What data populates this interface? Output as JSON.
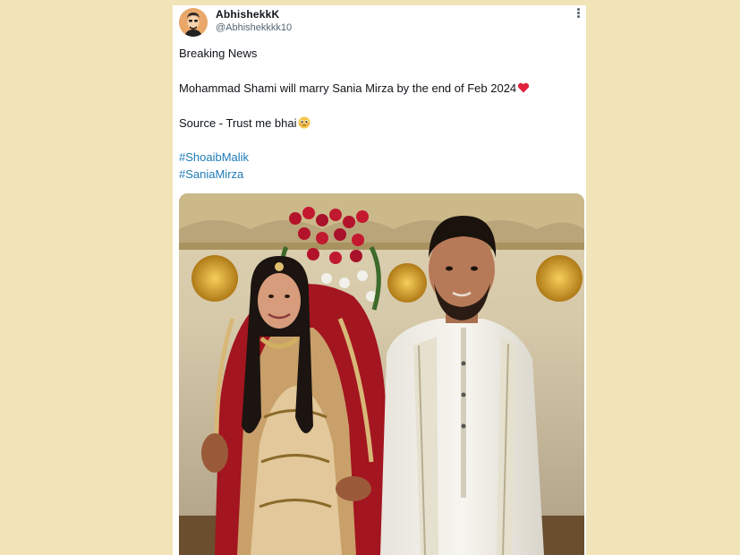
{
  "tweet": {
    "display_name": "AbhishekkK",
    "handle": "@Abhishekkkk10",
    "line1": "Breaking News",
    "line2": "Mohammad Shami will marry Sania Mirza by the end of Feb 2024",
    "line3": "Source - Trust me bhai",
    "hashtags": [
      "#ShoaibMalik",
      "#SaniaMirza"
    ],
    "more_icon": "more-vertical-icon",
    "heart_emoji": "red-heart-icon",
    "face_emoji": "pleading-face-icon"
  },
  "colors": {
    "background": "#f1e4b8",
    "card": "#ffffff",
    "hashtag": "#1d7bb8",
    "text": "#0f1419",
    "secondary": "#536471"
  }
}
